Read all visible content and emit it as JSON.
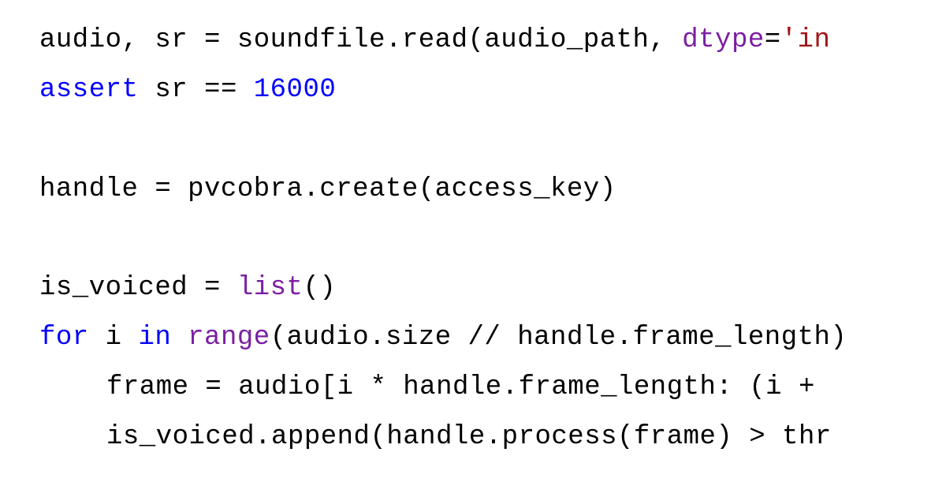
{
  "code": {
    "lines": [
      {
        "indent": 0,
        "tokens": [
          {
            "text": "audio, sr = soundfile.read(audio_path, ",
            "cls": "tok-default"
          },
          {
            "text": "dtype",
            "cls": "tok-param"
          },
          {
            "text": "=",
            "cls": "tok-default"
          },
          {
            "text": "'in",
            "cls": "tok-string"
          }
        ]
      },
      {
        "indent": 0,
        "tokens": [
          {
            "text": "assert",
            "cls": "tok-keyword"
          },
          {
            "text": " sr == ",
            "cls": "tok-default"
          },
          {
            "text": "16000",
            "cls": "tok-number"
          }
        ]
      },
      {
        "indent": 0,
        "tokens": [
          {
            "text": " ",
            "cls": "tok-default"
          }
        ]
      },
      {
        "indent": 0,
        "tokens": [
          {
            "text": "handle = pvcobra.create(access_key)",
            "cls": "tok-default"
          }
        ]
      },
      {
        "indent": 0,
        "tokens": [
          {
            "text": " ",
            "cls": "tok-default"
          }
        ]
      },
      {
        "indent": 0,
        "tokens": [
          {
            "text": "is_voiced = ",
            "cls": "tok-default"
          },
          {
            "text": "list",
            "cls": "tok-builtin"
          },
          {
            "text": "()",
            "cls": "tok-default"
          }
        ]
      },
      {
        "indent": 0,
        "tokens": [
          {
            "text": "for",
            "cls": "tok-keyword"
          },
          {
            "text": " i ",
            "cls": "tok-default"
          },
          {
            "text": "in",
            "cls": "tok-keyword"
          },
          {
            "text": " ",
            "cls": "tok-default"
          },
          {
            "text": "range",
            "cls": "tok-builtin"
          },
          {
            "text": "(audio.size // handle.frame_length)",
            "cls": "tok-default"
          }
        ]
      },
      {
        "indent": 1,
        "tokens": [
          {
            "text": "frame = audio[i * handle.frame_length: (i + ",
            "cls": "tok-default"
          }
        ]
      },
      {
        "indent": 1,
        "tokens": [
          {
            "text": "is_voiced.append(handle.process(frame) > thr",
            "cls": "tok-default"
          }
        ]
      }
    ]
  }
}
